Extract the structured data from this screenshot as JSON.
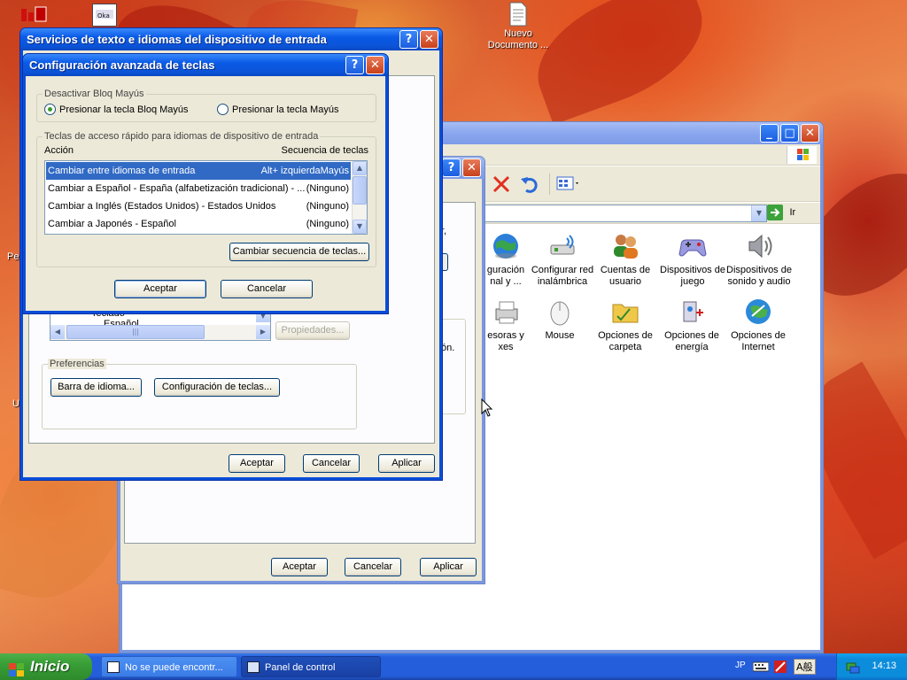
{
  "desktop": {
    "icons": [
      {
        "label": "Nuevo\nDocumento ...",
        "icon": "text-document-icon"
      }
    ],
    "partial_labels": [
      "Per",
      "U"
    ]
  },
  "lang_dialog": {
    "title": "Servicios de texto e idiomas del dispositivo de entrada",
    "partial_text": {
      "r_comma": "r,",
      "on_period": "ón."
    },
    "preferences_group": "Preferencias",
    "language_bar_button": "Barra de idioma...",
    "key_settings_button": "Configuración de teclas...",
    "properties_button": "Propiedades...",
    "installed_partial": "Teclado",
    "installed_partial2": "Español",
    "ok": "Aceptar",
    "cancel": "Cancelar",
    "apply": "Aplicar"
  },
  "advanced_dialog": {
    "title": "Configuración avanzada de teclas",
    "caps_group": "Desactivar Bloq Mayús",
    "caps_option_1": "Presionar la tecla Bloq Mayús",
    "caps_option_2": "Presionar la tecla Mayús",
    "hotkeys_group": "Teclas de acceso rápido para idiomas de dispositivo de entrada",
    "col_action": "Acción",
    "col_sequence": "Secuencia de teclas",
    "rows": [
      {
        "action": "Cambiar entre idiomas de entrada",
        "sequence": "Alt+ izquierdaMayús"
      },
      {
        "action": "Cambiar a Español - España (alfabetización tradicional) - ...",
        "sequence": "(Ninguno)"
      },
      {
        "action": "Cambiar a Inglés (Estados Unidos) - Estados Unidos",
        "sequence": "(Ninguno)"
      },
      {
        "action": "Cambiar a Japonés - Español",
        "sequence": "(Ninguno)"
      }
    ],
    "change_sequence_button": "Cambiar secuencia de teclas...",
    "ok": "Aceptar",
    "cancel": "Cancelar"
  },
  "regional_dialog": {
    "ok": "Aceptar",
    "cancel": "Cancelar",
    "apply": "Aplicar"
  },
  "control_panel": {
    "go_label": "Ir",
    "items": [
      {
        "label": "guración\nnal y ...",
        "icon": "globe-icon"
      },
      {
        "label": "Configurar red\ninalámbrica",
        "icon": "wireless-network-icon"
      },
      {
        "label": "Cuentas de\nusuario",
        "icon": "user-accounts-icon"
      },
      {
        "label": "Dispositivos de\njuego",
        "icon": "game-controller-icon"
      },
      {
        "label": "Dispositivos de\nsonido y audio",
        "icon": "speaker-icon"
      },
      {
        "label": "esoras y\nxes",
        "icon": "printer-icon"
      },
      {
        "label": "Mouse",
        "icon": "mouse-icon"
      },
      {
        "label": "Opciones de\ncarpeta",
        "icon": "folder-icon"
      },
      {
        "label": "Opciones de\nenergía",
        "icon": "power-icon"
      },
      {
        "label": "Opciones de\nInternet",
        "icon": "internet-globe-icon"
      }
    ]
  },
  "taskbar": {
    "start_label": "Inicio",
    "tasks": [
      {
        "label": "No se puede encontr..."
      },
      {
        "label": "Panel de control"
      }
    ],
    "tray": {
      "lang": "JP",
      "ime": "A般",
      "clock": "14:13"
    }
  }
}
